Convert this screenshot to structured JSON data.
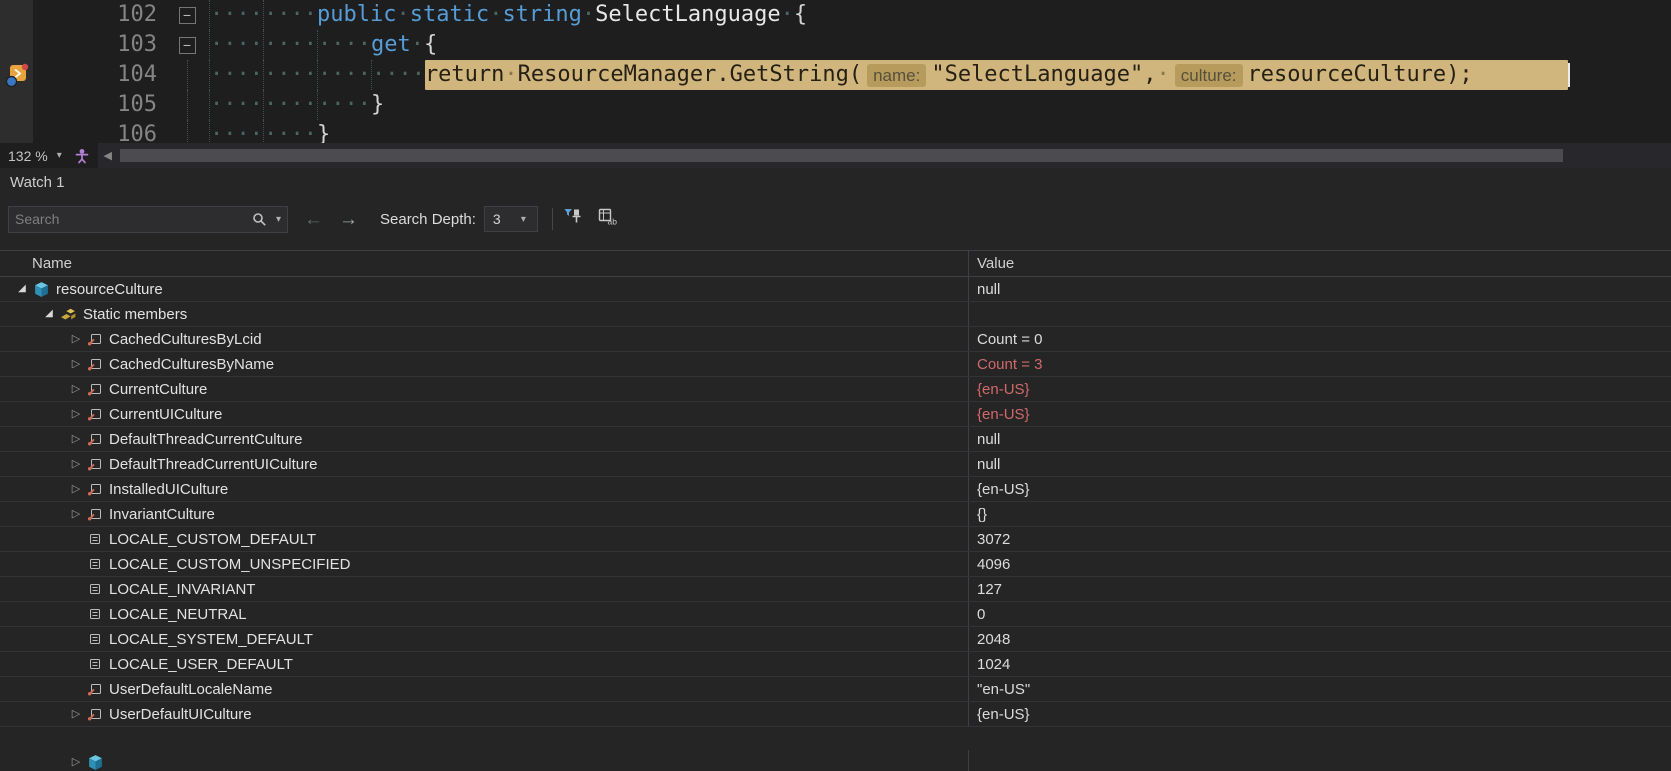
{
  "colors": {
    "highlight": "#d0b67d",
    "badge_bg": "#b79b5c",
    "keyword": "#569cd6",
    "changed_value": "#d16969"
  },
  "editor": {
    "zoom_label": "132 %",
    "lines": [
      {
        "num": "102",
        "fold": "minus",
        "indent": 2,
        "tokens": [
          {
            "t": "public",
            "c": "kw"
          },
          {
            "t": "·",
            "c": "ws"
          },
          {
            "t": "static",
            "c": "kw"
          },
          {
            "t": "·",
            "c": "ws"
          },
          {
            "t": "string",
            "c": "kw"
          },
          {
            "t": "·",
            "c": "ws"
          },
          {
            "t": "SelectLanguage",
            "c": "id"
          },
          {
            "t": "·",
            "c": "ws"
          },
          {
            "t": "{",
            "c": "pn"
          }
        ]
      },
      {
        "num": "103",
        "fold": "minus",
        "indent": 3,
        "tokens": [
          {
            "t": "get",
            "c": "kw"
          },
          {
            "t": "·",
            "c": "ws"
          },
          {
            "t": "{",
            "c": "pn"
          }
        ]
      },
      {
        "num": "104",
        "fold": "guide",
        "indent": 4,
        "highlight": true,
        "tokens": [
          {
            "t": "return",
            "c": "hc"
          },
          {
            "t": "·",
            "c": "hw"
          },
          {
            "t": "ResourceManager",
            "c": "hc"
          },
          {
            "t": ".",
            "c": "hc"
          },
          {
            "t": "GetString",
            "c": "hc"
          },
          {
            "t": "(",
            "c": "hc"
          },
          {
            "t": "name:",
            "c": "badge"
          },
          {
            "t": "\"SelectLanguage\"",
            "c": "hc"
          },
          {
            "t": ",",
            "c": "hc"
          },
          {
            "t": "·",
            "c": "hw"
          },
          {
            "t": "culture:",
            "c": "badge"
          },
          {
            "t": "resourceCulture",
            "c": "hc"
          },
          {
            "t": ");",
            "c": "hc"
          }
        ]
      },
      {
        "num": "105",
        "fold": "guide",
        "indent": 3,
        "tokens": [
          {
            "t": "}",
            "c": "pn"
          }
        ]
      },
      {
        "num": "106",
        "fold": "guide",
        "indent": 2,
        "tokens": [
          {
            "t": "}",
            "c": "pn"
          }
        ]
      }
    ]
  },
  "watch": {
    "title": "Watch 1",
    "search": {
      "placeholder": "Search"
    },
    "depth": {
      "label": "Search Depth:",
      "value": "3"
    },
    "columns": {
      "name": "Name",
      "value": "Value"
    },
    "rows": [
      {
        "name": "resourceCulture",
        "value": "null",
        "depth": 0,
        "expand": "expanded",
        "icon": "class",
        "changed": false
      },
      {
        "name": "Static members",
        "value": "",
        "depth": 1,
        "expand": "expanded",
        "icon": "static",
        "changed": false
      },
      {
        "name": "CachedCulturesByLcid",
        "value": "Count = 0",
        "depth": 2,
        "expand": "collapsed",
        "icon": "field",
        "changed": false
      },
      {
        "name": "CachedCulturesByName",
        "value": "Count = 3",
        "depth": 2,
        "expand": "collapsed",
        "icon": "field",
        "changed": true
      },
      {
        "name": "CurrentCulture",
        "value": "{en-US}",
        "depth": 2,
        "expand": "collapsed",
        "icon": "field",
        "changed": true
      },
      {
        "name": "CurrentUICulture",
        "value": "{en-US}",
        "depth": 2,
        "expand": "collapsed",
        "icon": "field",
        "changed": true
      },
      {
        "name": "DefaultThreadCurrentCulture",
        "value": "null",
        "depth": 2,
        "expand": "collapsed",
        "icon": "field",
        "changed": false
      },
      {
        "name": "DefaultThreadCurrentUICulture",
        "value": "null",
        "depth": 2,
        "expand": "collapsed",
        "icon": "field",
        "changed": false
      },
      {
        "name": "InstalledUICulture",
        "value": "{en-US}",
        "depth": 2,
        "expand": "collapsed",
        "icon": "field",
        "changed": false
      },
      {
        "name": "InvariantCulture",
        "value": "{}",
        "depth": 2,
        "expand": "collapsed",
        "icon": "field",
        "changed": false
      },
      {
        "name": "LOCALE_CUSTOM_DEFAULT",
        "value": "3072",
        "depth": 2,
        "expand": "none",
        "icon": "const",
        "changed": false
      },
      {
        "name": "LOCALE_CUSTOM_UNSPECIFIED",
        "value": "4096",
        "depth": 2,
        "expand": "none",
        "icon": "const",
        "changed": false
      },
      {
        "name": "LOCALE_INVARIANT",
        "value": "127",
        "depth": 2,
        "expand": "none",
        "icon": "const",
        "changed": false
      },
      {
        "name": "LOCALE_NEUTRAL",
        "value": "0",
        "depth": 2,
        "expand": "none",
        "icon": "const",
        "changed": false
      },
      {
        "name": "LOCALE_SYSTEM_DEFAULT",
        "value": "2048",
        "depth": 2,
        "expand": "none",
        "icon": "const",
        "changed": false
      },
      {
        "name": "LOCALE_USER_DEFAULT",
        "value": "1024",
        "depth": 2,
        "expand": "none",
        "icon": "const",
        "changed": false
      },
      {
        "name": "UserDefaultLocaleName",
        "value": "\"en-US\"",
        "depth": 2,
        "expand": "none",
        "icon": "field",
        "changed": false
      },
      {
        "name": "UserDefaultUICulture",
        "value": "{en-US}",
        "depth": 2,
        "expand": "collapsed",
        "icon": "field",
        "changed": false
      },
      {
        "name": "",
        "value": "",
        "depth": 2,
        "expand": "collapsed",
        "icon": "class",
        "changed": false,
        "partial": true
      }
    ]
  }
}
